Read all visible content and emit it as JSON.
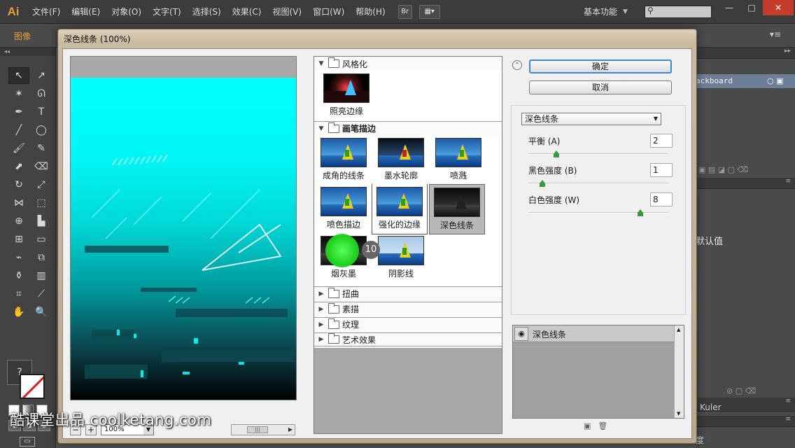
{
  "app": {
    "logo": "Ai",
    "menu": [
      "文件(F)",
      "编辑(E)",
      "对象(O)",
      "文字(T)",
      "选择(S)",
      "效果(C)",
      "视图(V)",
      "窗口(W)",
      "帮助(H)"
    ],
    "bridge_label": "Br",
    "workspace": "基本功能",
    "window_buttons": [
      "—",
      "□",
      "✕"
    ]
  },
  "control_bar": {
    "label": "图像",
    "panel_menu": "▾≡"
  },
  "right_panels": {
    "artboard_label": "ackboard",
    "default_value_label": "默认值",
    "kuler_label": "Kuler",
    "opacity_label": "度"
  },
  "dialog": {
    "title": "深色线条 (100%)",
    "ok_label": "确定",
    "cancel_label": "取消",
    "zoom_value": "100%",
    "categories": {
      "stylize": "风格化",
      "brush_strokes": "画笔描边",
      "distort": "扭曲",
      "sketch": "素描",
      "texture": "纹理",
      "artistic": "艺术效果"
    },
    "stylize_filters": [
      {
        "label": "照亮边缘",
        "style": "glow"
      }
    ],
    "brush_filters": [
      {
        "label": "成角的线条",
        "style": "normal"
      },
      {
        "label": "墨水轮廓",
        "style": "ink"
      },
      {
        "label": "喷溅",
        "style": "normal"
      },
      {
        "label": "喷色描边",
        "style": "normal"
      },
      {
        "label": "强化的边缘",
        "style": "normal"
      },
      {
        "label": "深色线条",
        "style": "dark",
        "selected": true
      },
      {
        "label": "烟灰墨",
        "style": "dark"
      },
      {
        "label": "阴影线",
        "style": "pale"
      }
    ],
    "step_badge": "10",
    "filter_select": "深色线条",
    "params": [
      {
        "label": "平衡 (A)",
        "value": "2",
        "level": 0.2
      },
      {
        "label": "黑色强度 (B)",
        "value": "1",
        "level": 0.1
      },
      {
        "label": "白色强度 (W)",
        "value": "8",
        "level": 0.8
      }
    ],
    "layer_label": "深色线条"
  },
  "watermark": "酷课堂出品 coolketang.com",
  "colors": {
    "accent": "#e8a030",
    "preview_cyan": "#00ffff",
    "ok_focus": "#3a88d8",
    "slider_knob": "#3a9a3a"
  }
}
